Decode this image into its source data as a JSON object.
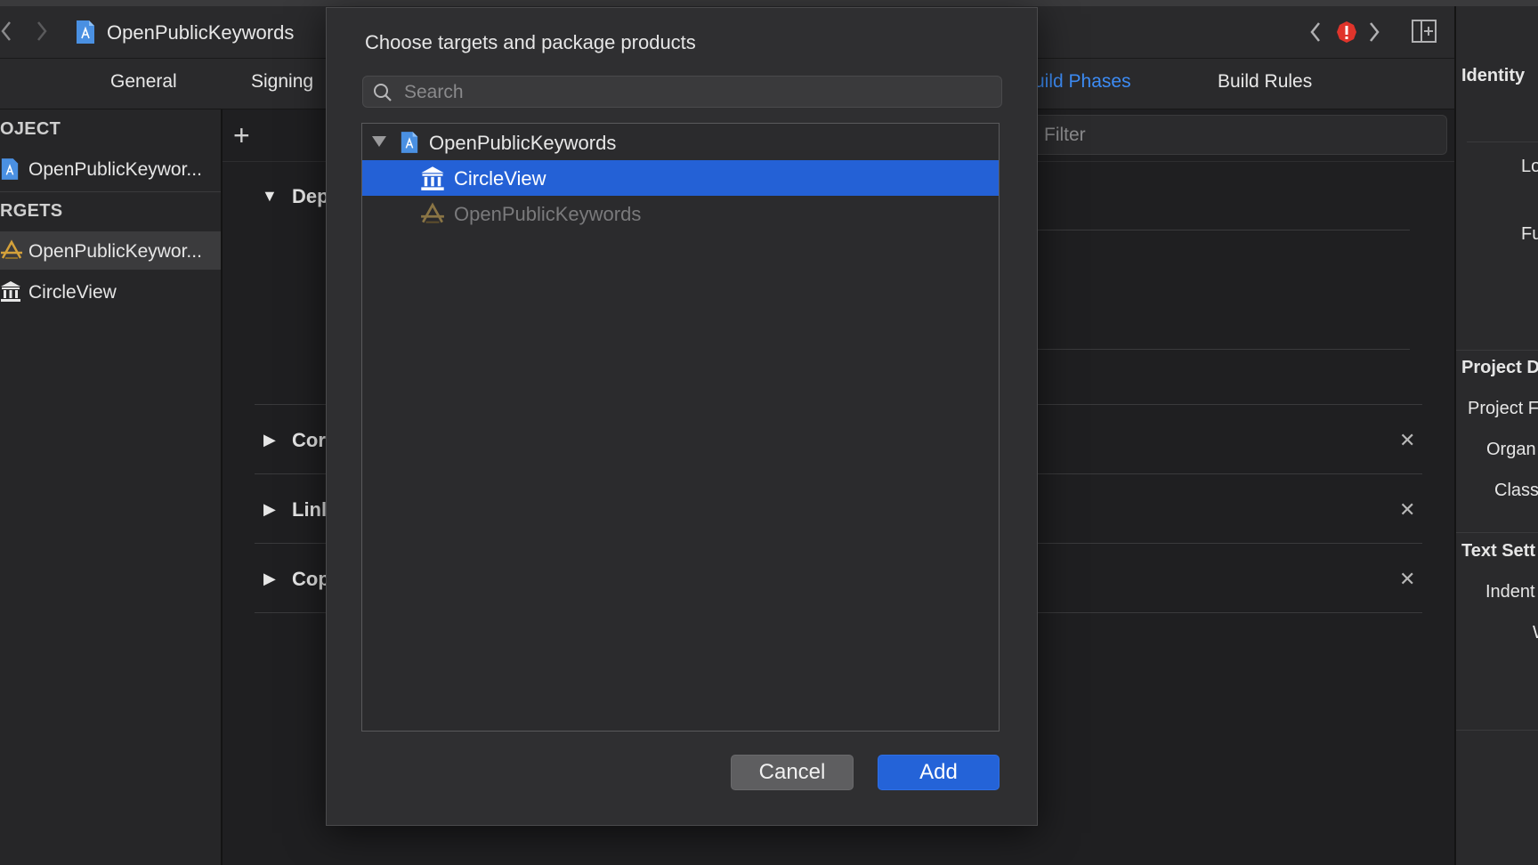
{
  "toolbar": {
    "project_title": "OpenPublicKeywords"
  },
  "tabs": {
    "general": "General",
    "signing": "Signing",
    "build_phases": "uild Phases",
    "build_rules": "Build Rules"
  },
  "navigator": {
    "project_header": "OJECT",
    "project_item": "OpenPublicKeywor...",
    "targets_header": "RGETS",
    "target_app": "OpenPublicKeywor...",
    "target_framework": "CircleView"
  },
  "editor": {
    "filter_placeholder": "Filter",
    "phases": [
      "Dep",
      "Cor",
      "Linl",
      "Cop"
    ]
  },
  "inspector": {
    "identity": "Identity",
    "lo": "Lo",
    "fu": "Fu",
    "project_doc": "Project D",
    "project_f": "Project F",
    "organ": "Organ",
    "class": "Class",
    "text_settings": "Text Sett",
    "indent": "Indent",
    "w": "W"
  },
  "dialog": {
    "title": "Choose targets and package products",
    "search_placeholder": "Search",
    "items": [
      {
        "label": "OpenPublicKeywords",
        "kind": "project"
      },
      {
        "label": "CircleView",
        "kind": "framework",
        "selected": true
      },
      {
        "label": "OpenPublicKeywords",
        "kind": "app",
        "disabled": true
      }
    ],
    "cancel_label": "Cancel",
    "add_label": "Add"
  },
  "colors": {
    "accent": "#2461d6",
    "error": "#e0342b",
    "tab_active": "#3d8cf5"
  }
}
